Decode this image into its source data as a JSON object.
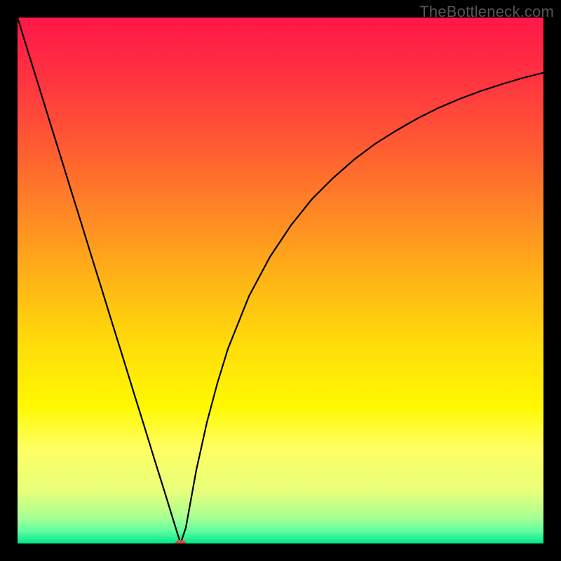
{
  "watermark": "TheBottleneck.com",
  "chart_data": {
    "type": "line",
    "title": "",
    "xlabel": "",
    "ylabel": "",
    "xlim": [
      0,
      100
    ],
    "ylim": [
      0,
      100
    ],
    "background": {
      "type": "gradient-vertical",
      "stops": [
        {
          "pos": 0.0,
          "color": "#ff1748"
        },
        {
          "pos": 0.12,
          "color": "#ff3440"
        },
        {
          "pos": 0.25,
          "color": "#ff5d32"
        },
        {
          "pos": 0.38,
          "color": "#ff8a24"
        },
        {
          "pos": 0.5,
          "color": "#ffb516"
        },
        {
          "pos": 0.62,
          "color": "#ffdc0a"
        },
        {
          "pos": 0.74,
          "color": "#fff802"
        },
        {
          "pos": 0.82,
          "color": "#ffff63"
        },
        {
          "pos": 0.9,
          "color": "#e8ff7a"
        },
        {
          "pos": 0.95,
          "color": "#a8ff92"
        },
        {
          "pos": 0.975,
          "color": "#66ffa0"
        },
        {
          "pos": 1.0,
          "color": "#00e78a"
        }
      ]
    },
    "series": [
      {
        "name": "bottleneck-curve",
        "color": "#000000",
        "x": [
          0,
          2,
          4,
          6,
          8,
          10,
          12,
          14,
          16,
          18,
          20,
          22,
          24,
          26,
          28,
          30,
          31,
          32,
          34,
          36,
          38,
          40,
          44,
          48,
          52,
          56,
          60,
          64,
          68,
          72,
          76,
          80,
          84,
          88,
          92,
          96,
          100
        ],
        "values": [
          100,
          93.5,
          87.1,
          80.6,
          74.2,
          67.7,
          61.3,
          54.8,
          48.4,
          41.9,
          35.5,
          29.0,
          22.6,
          16.1,
          9.7,
          3.2,
          0.0,
          3.0,
          14.0,
          23.0,
          30.5,
          37.0,
          47.0,
          54.5,
          60.5,
          65.5,
          69.5,
          73.0,
          76.0,
          78.5,
          80.8,
          82.8,
          84.5,
          86.0,
          87.3,
          88.5,
          89.5
        ]
      }
    ],
    "marker": {
      "x": 31,
      "y": 0,
      "color": "#d14a4a",
      "rx": 8,
      "ry": 5
    }
  }
}
